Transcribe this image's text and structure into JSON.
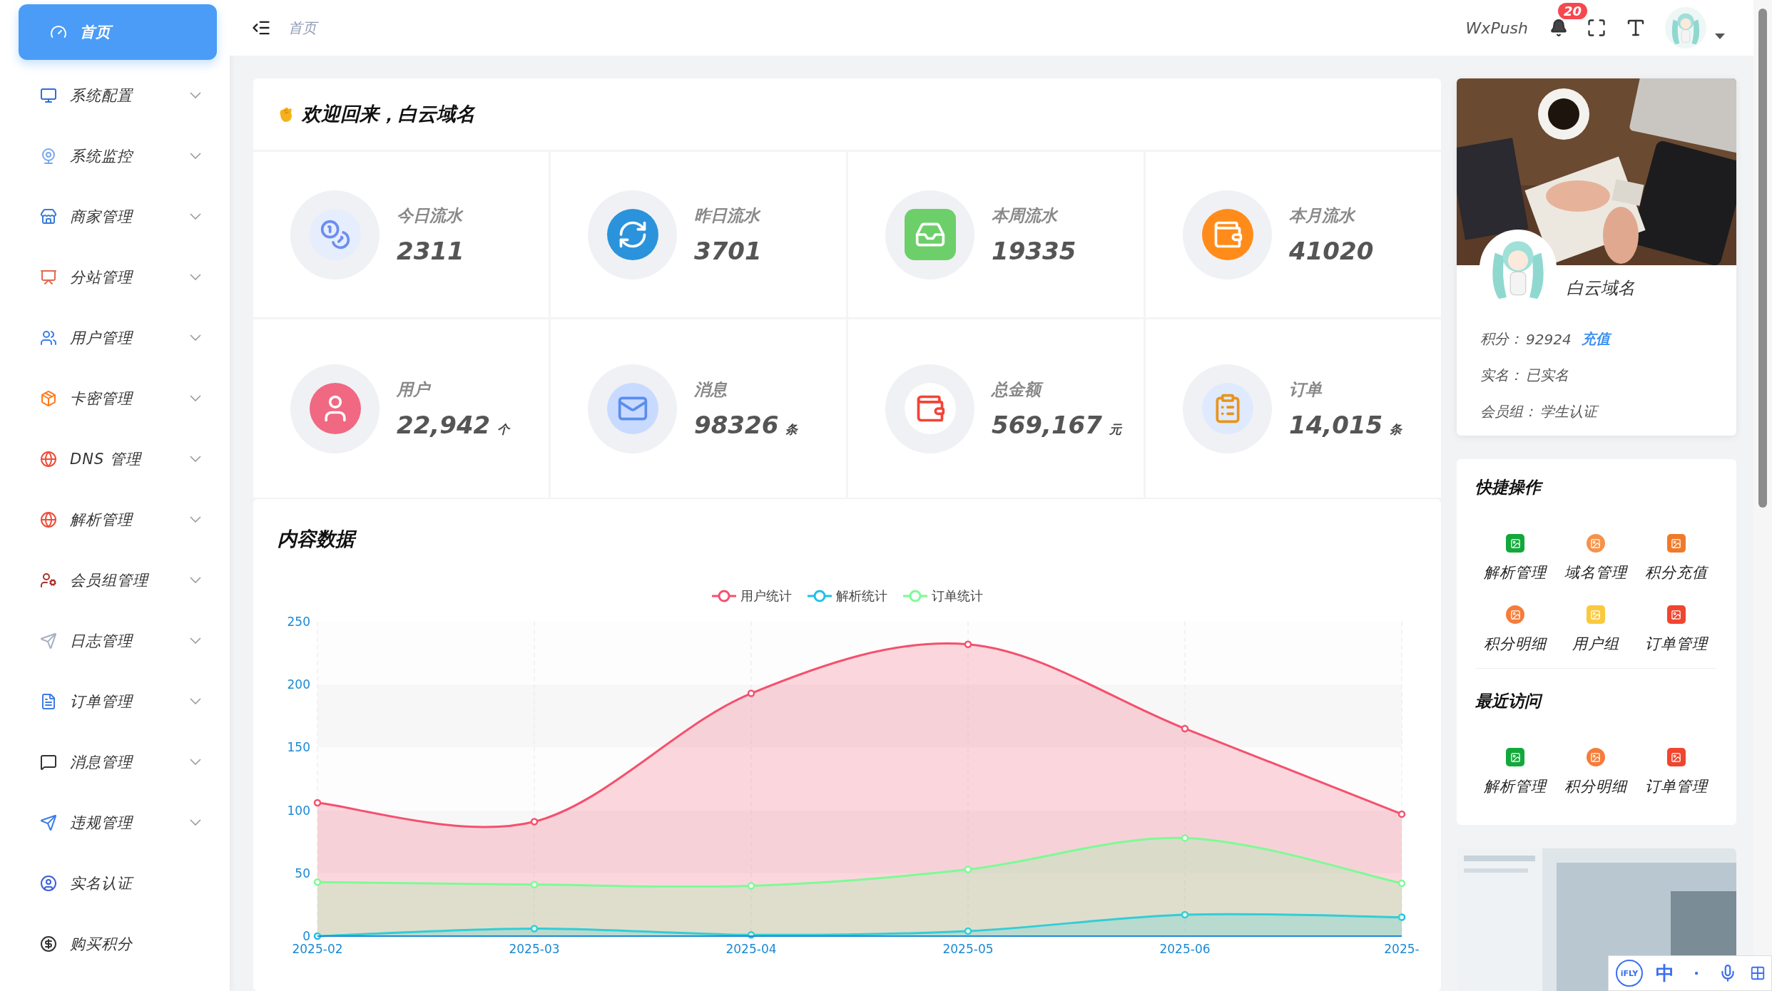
{
  "sidebar": {
    "items": [
      {
        "label": "首页",
        "selected": true,
        "expandable": false
      },
      {
        "label": "系统配置",
        "selected": false,
        "expandable": true
      },
      {
        "label": "系统监控",
        "selected": false,
        "expandable": true
      },
      {
        "label": "商家管理",
        "selected": false,
        "expandable": true
      },
      {
        "label": "分站管理",
        "selected": false,
        "expandable": true
      },
      {
        "label": "用户管理",
        "selected": false,
        "expandable": true
      },
      {
        "label": "卡密管理",
        "selected": false,
        "expandable": true
      },
      {
        "label": "DNS 管理",
        "selected": false,
        "expandable": true
      },
      {
        "label": "解析管理",
        "selected": false,
        "expandable": true
      },
      {
        "label": "会员组管理",
        "selected": false,
        "expandable": true
      },
      {
        "label": "日志管理",
        "selected": false,
        "expandable": true
      },
      {
        "label": "订单管理",
        "selected": false,
        "expandable": true
      },
      {
        "label": "消息管理",
        "selected": false,
        "expandable": true
      },
      {
        "label": "违规管理",
        "selected": false,
        "expandable": true
      },
      {
        "label": "实名认证",
        "selected": false,
        "expandable": false
      },
      {
        "label": "购买积分",
        "selected": false,
        "expandable": false
      }
    ]
  },
  "header": {
    "breadcrumb": "首页",
    "app_name": "WxPush",
    "notification_count": "20"
  },
  "welcome": {
    "title": "欢迎回来，白云域名"
  },
  "stats": [
    {
      "label": "今日流水",
      "value": "2311"
    },
    {
      "label": "昨日流水",
      "value": "3701"
    },
    {
      "label": "本周流水",
      "value": "19335"
    },
    {
      "label": "本月流水",
      "value": "41020"
    },
    {
      "label": "用户",
      "value": "22,942",
      "unit": "个"
    },
    {
      "label": "消息",
      "value": "98326",
      "unit": "条"
    },
    {
      "label": "总金额",
      "value": "569,167",
      "unit": "元"
    },
    {
      "label": "订单",
      "value": "14,015",
      "unit": "条"
    }
  ],
  "content_data": {
    "title": "内容数据",
    "chart_data": {
      "type": "area",
      "categories": [
        "2025-02",
        "2025-03",
        "2025-04",
        "2025-05",
        "2025-06",
        "2025-"
      ],
      "ylim": [
        0,
        250
      ],
      "yticks": [
        0,
        50,
        100,
        150,
        200,
        250
      ],
      "grid": true,
      "legend": "top",
      "series": [
        {
          "name": "用户统计",
          "color": "#f5506e",
          "values": [
            106,
            91,
            193,
            232,
            165,
            97
          ]
        },
        {
          "name": "解析统计",
          "color": "#1ec0e8",
          "values": [
            0,
            6,
            1,
            4,
            17,
            15
          ]
        },
        {
          "name": "订单统计",
          "color": "#7dfa96",
          "values": [
            43,
            41,
            40,
            53,
            78,
            42
          ]
        }
      ]
    }
  },
  "profile": {
    "name": "白云域名",
    "points_label": "积分：",
    "points": "92924",
    "recharge": "充值",
    "rows": [
      {
        "label": "实名：",
        "value": "已实名"
      },
      {
        "label": "会员组：",
        "value": "学生认证"
      }
    ]
  },
  "quick_actions": {
    "title": "快捷操作",
    "items": [
      "解析管理",
      "域名管理",
      "积分充值",
      "积分明细",
      "用户组",
      "订单管理"
    ]
  },
  "recent": {
    "title": "最近访问",
    "items": [
      "解析管理",
      "积分明细",
      "订单管理"
    ]
  },
  "ime_bar": {
    "logo": "iFLY",
    "mode": "中"
  }
}
